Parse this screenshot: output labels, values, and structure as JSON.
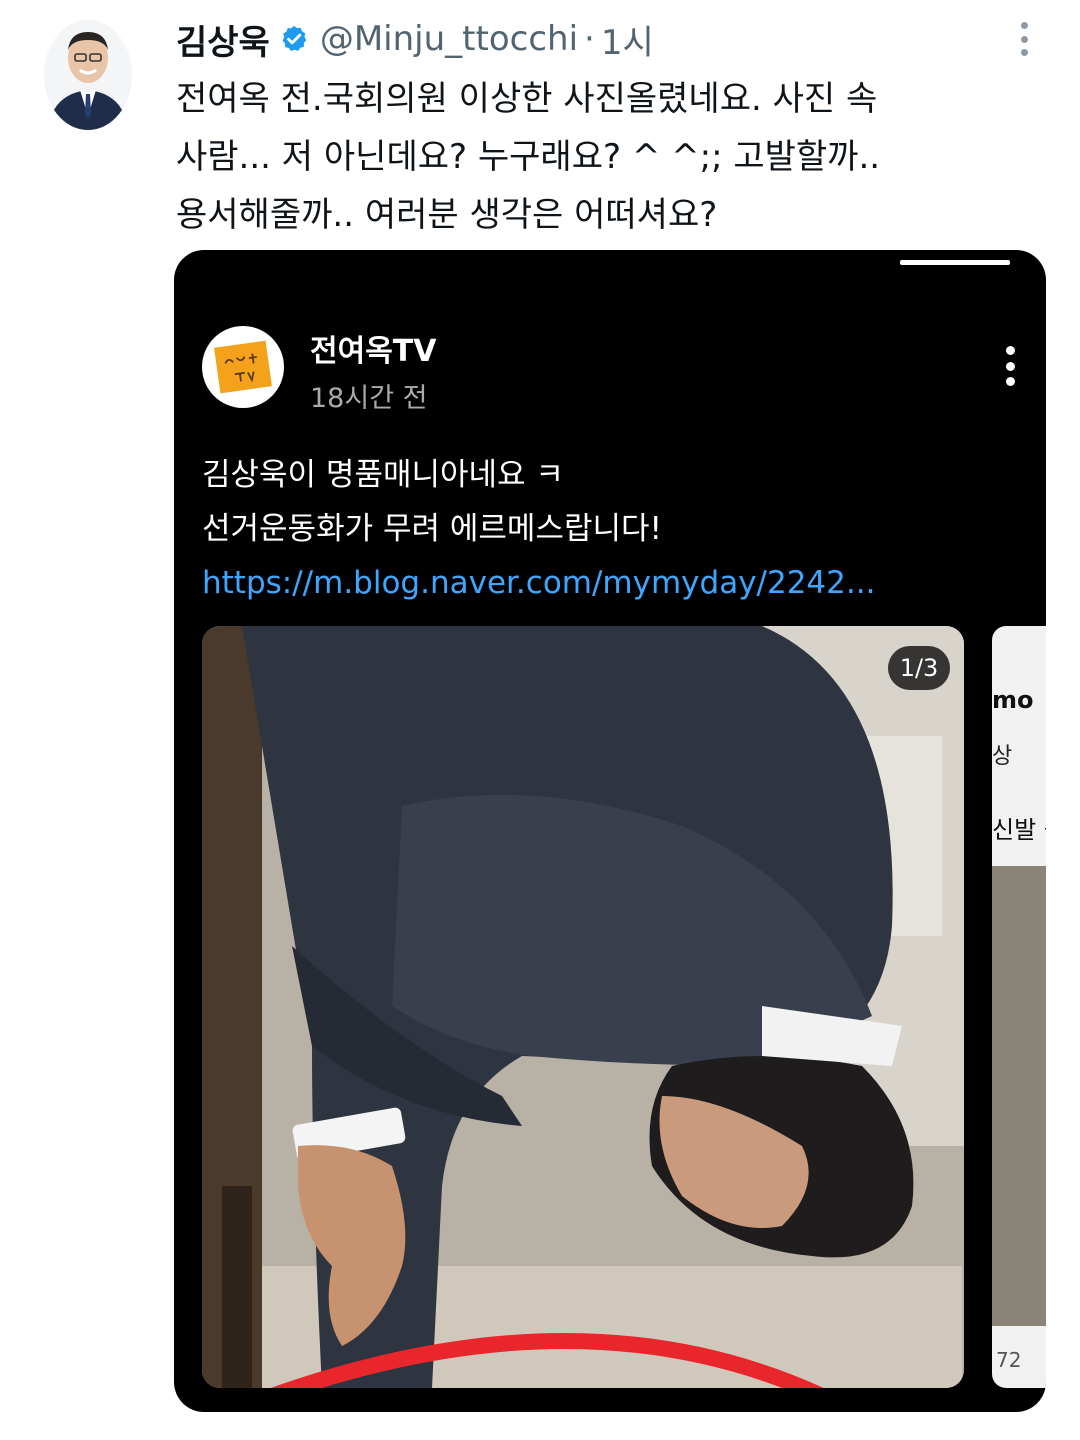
{
  "tweet": {
    "author_name": "김상욱",
    "handle": "@Minju_ttocchi",
    "separator": "·",
    "time": "1시",
    "verified_icon": "verified-badge-icon",
    "text_lines": [
      "전여옥 전.국회의원 이상한 사진올렸네요. 사진 속",
      "사람... 저 아닌데요? 누구래요? ^ ^;; 고발할까..",
      "용서해줄까..  여러분 생각은 어떠셔요?"
    ]
  },
  "embedded_post": {
    "channel_name": "전여옥TV",
    "time_ago": "18시간 전",
    "avatar_text": "전여옥 TV",
    "body_lines": [
      "김상욱이 명품매니아네요 ㅋ",
      "선거운동화가 무려 에르메스랍니다!"
    ],
    "link": "https://m.blog.naver.com/mymyday/2242...",
    "image_counter": "1/3",
    "second_image": {
      "text_top": "mo",
      "text_mid": "상",
      "text_mid2": "신발 출",
      "comment_count": "72"
    }
  },
  "colors": {
    "text_primary": "#0f1419",
    "text_secondary": "#536471",
    "verified": "#1d9bf0",
    "link": "#3ea6ff",
    "card_bg": "#000000",
    "highlight_circle": "#e8262b"
  }
}
